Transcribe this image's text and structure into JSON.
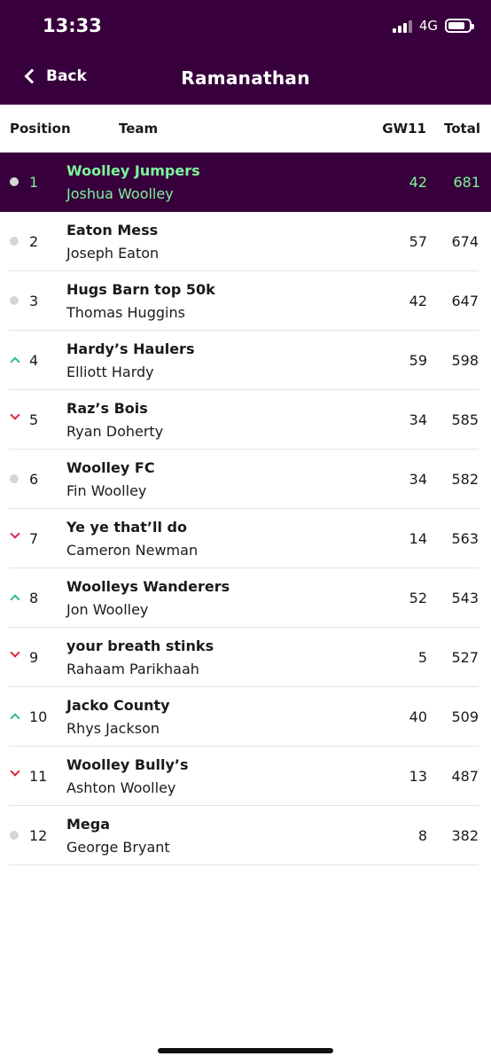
{
  "status_bar": {
    "time": "13:33",
    "network": "4G"
  },
  "nav": {
    "back_label": "Back",
    "title": "Ramanathan"
  },
  "table": {
    "headers": {
      "position": "Position",
      "team": "Team",
      "gw": "GW11",
      "total": "Total"
    },
    "rows": [
      {
        "movement": "same",
        "position": "1",
        "team": "Woolley Jumpers",
        "manager": "Joshua Woolley",
        "gw": "42",
        "total": "681"
      },
      {
        "movement": "same",
        "position": "2",
        "team": "Eaton Mess",
        "manager": "Joseph Eaton",
        "gw": "57",
        "total": "674"
      },
      {
        "movement": "same",
        "position": "3",
        "team": "Hugs Barn top 50k",
        "manager": "Thomas Huggins",
        "gw": "42",
        "total": "647"
      },
      {
        "movement": "up",
        "position": "4",
        "team": "Hardy’s Haulers",
        "manager": "Elliott Hardy",
        "gw": "59",
        "total": "598"
      },
      {
        "movement": "down",
        "position": "5",
        "team": "Raz’s Bois",
        "manager": "Ryan Doherty",
        "gw": "34",
        "total": "585"
      },
      {
        "movement": "same",
        "position": "6",
        "team": "Woolley FC",
        "manager": "Fin Woolley",
        "gw": "34",
        "total": "582"
      },
      {
        "movement": "down",
        "position": "7",
        "team": "Ye ye that’ll do",
        "manager": "Cameron Newman",
        "gw": "14",
        "total": "563"
      },
      {
        "movement": "up",
        "position": "8",
        "team": "Woolleys Wanderers",
        "manager": "Jon Woolley",
        "gw": "52",
        "total": "543"
      },
      {
        "movement": "down",
        "position": "9",
        "team": "your breath stinks",
        "manager": "Rahaam Parikhaah",
        "gw": "5",
        "total": "527"
      },
      {
        "movement": "up",
        "position": "10",
        "team": "Jacko County",
        "manager": "Rhys Jackson",
        "gw": "40",
        "total": "509"
      },
      {
        "movement": "down",
        "position": "11",
        "team": "Woolley Bully’s",
        "manager": "Ashton Woolley",
        "gw": "13",
        "total": "487"
      },
      {
        "movement": "same",
        "position": "12",
        "team": "Mega",
        "manager": "George Bryant",
        "gw": "8",
        "total": "382"
      }
    ]
  },
  "colors": {
    "header_bg": "#37003c",
    "highlight_text": "#7cf49a",
    "up": "#2fbf7a",
    "down": "#e0233d",
    "same": "#d6d6d6"
  },
  "icons": {
    "back": "chevron-left-icon",
    "up": "chevron-up-icon",
    "down": "chevron-down-icon",
    "same": "dot-icon",
    "signal": "cellular-signal-icon",
    "battery": "battery-icon"
  }
}
